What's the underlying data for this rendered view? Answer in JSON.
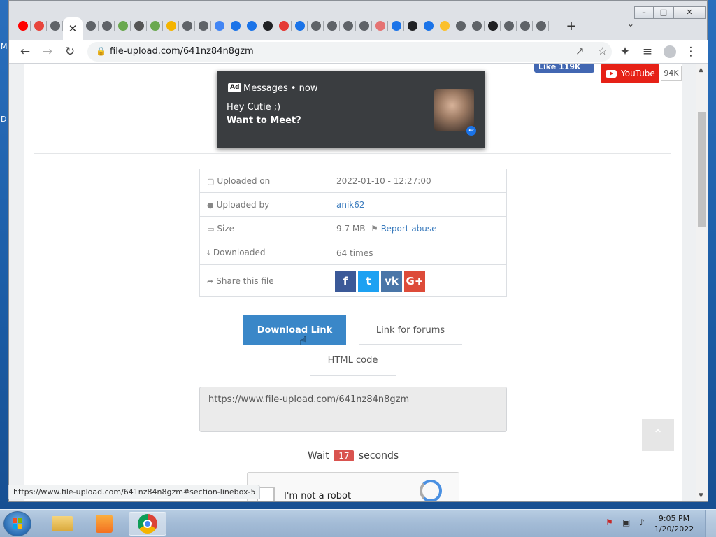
{
  "browser": {
    "tabs": [
      {
        "icon": "youtube-icon",
        "color": "#ff0000"
      },
      {
        "icon": "compass-icon",
        "color": "#e8453c"
      },
      {
        "icon": "globe-icon",
        "color": "#5f6368"
      },
      {
        "icon": "close-icon",
        "color": "#333333",
        "active": true
      },
      {
        "icon": "globe-icon",
        "color": "#5f6368"
      },
      {
        "icon": "globe-icon",
        "color": "#5f6368"
      },
      {
        "icon": "leaf-icon",
        "color": "#6aa84f"
      },
      {
        "icon": "shield-icon",
        "color": "#555555"
      },
      {
        "icon": "leaf-icon",
        "color": "#6aa84f"
      },
      {
        "icon": "page-icon",
        "color": "#f4b400"
      },
      {
        "icon": "globe-icon",
        "color": "#5f6368"
      },
      {
        "icon": "globe-icon",
        "color": "#5f6368"
      },
      {
        "icon": "page-icon",
        "color": "#4285f4"
      },
      {
        "icon": "s-icon",
        "color": "#1a73e8"
      },
      {
        "icon": "s-icon",
        "color": "#1a73e8"
      },
      {
        "icon": "pulse-icon",
        "color": "#202124"
      },
      {
        "icon": "gift-icon",
        "color": "#e53935"
      },
      {
        "icon": "s-icon",
        "color": "#1a73e8"
      },
      {
        "icon": "globe-icon",
        "color": "#5f6368"
      },
      {
        "icon": "globe-icon",
        "color": "#5f6368"
      },
      {
        "icon": "globe-icon",
        "color": "#5f6368"
      },
      {
        "icon": "globe-icon",
        "color": "#5f6368"
      },
      {
        "icon": "square-icon",
        "color": "#e57373"
      },
      {
        "icon": "s-icon",
        "color": "#1a73e8"
      },
      {
        "icon": "pulse-icon",
        "color": "#202124"
      },
      {
        "icon": "s-icon",
        "color": "#1a73e8"
      },
      {
        "icon": "smile-icon",
        "color": "#fbc02d"
      },
      {
        "icon": "globe-icon",
        "color": "#5f6368"
      },
      {
        "icon": "globe-icon",
        "color": "#5f6368"
      },
      {
        "icon": "pulse-icon",
        "color": "#202124"
      },
      {
        "icon": "globe-icon",
        "color": "#5f6368"
      },
      {
        "icon": "globe-icon",
        "color": "#5f6368"
      },
      {
        "icon": "globe-icon",
        "color": "#5f6368"
      }
    ],
    "url": "file-upload.com/641nz84n8gzm",
    "status_url": "https://www.file-upload.com/641nz84n8gzm#section-linebox-5"
  },
  "social": {
    "fb_like": "Like 119K",
    "youtube_label": "YouTube",
    "youtube_count": "94K"
  },
  "ad": {
    "badge": "Ad",
    "header": "Messages • now",
    "line1": "Hey Cutie ;)",
    "line2": "Want to Meet?"
  },
  "file_info": {
    "uploaded_on_label": "Uploaded on",
    "uploaded_on": "2022-01-10 - 12:27:00",
    "uploaded_by_label": "Uploaded by",
    "uploaded_by": "anik62",
    "size_label": "Size",
    "size": "9.7 MB",
    "report_abuse": "Report abuse",
    "downloaded_label": "Downloaded",
    "downloaded": "64 times",
    "share_label": "Share this file",
    "share_buttons": [
      {
        "name": "facebook",
        "glyph": "f",
        "color": "#3b5998"
      },
      {
        "name": "twitter",
        "glyph": "t",
        "color": "#1da1f2"
      },
      {
        "name": "vk",
        "glyph": "vk",
        "color": "#4a76a8"
      },
      {
        "name": "google-plus",
        "glyph": "G+",
        "color": "#dd4b39"
      }
    ]
  },
  "tabs": {
    "download_link": "Download Link",
    "link_for_forums": "Link for forums",
    "html_code": "HTML code"
  },
  "link_box": {
    "value": "https://www.file-upload.com/641nz84n8gzm"
  },
  "wait": {
    "prefix": "Wait",
    "seconds": "17",
    "suffix": "seconds"
  },
  "captcha": {
    "label": "I'm not a robot"
  },
  "desktop": {
    "fragments": [
      "M",
      "D"
    ]
  },
  "taskbar": {
    "time": "9:05 PM",
    "date": "1/20/2022"
  }
}
